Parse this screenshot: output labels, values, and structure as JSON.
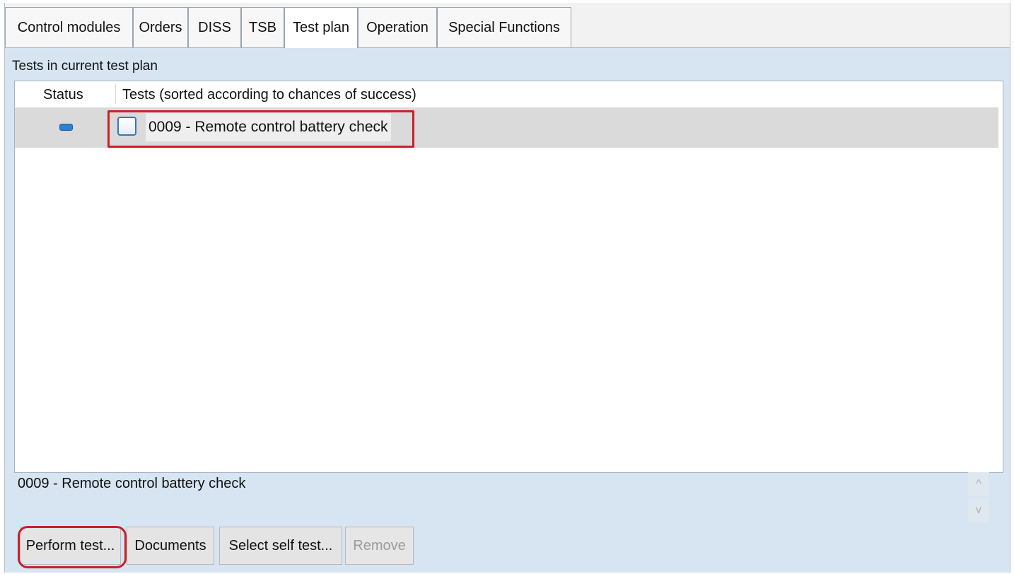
{
  "tabs": [
    {
      "label": "Control modules",
      "active": false
    },
    {
      "label": "Orders",
      "active": false
    },
    {
      "label": "DISS",
      "active": false
    },
    {
      "label": "TSB",
      "active": false
    },
    {
      "label": "Test plan",
      "active": true
    },
    {
      "label": "Operation",
      "active": false
    },
    {
      "label": "Special Functions",
      "active": false
    }
  ],
  "section_title": "Tests in current test plan",
  "table": {
    "columns": [
      "Status",
      "Tests (sorted according to chances of success)"
    ],
    "rows": [
      {
        "status_icon": "in-progress-bar-icon",
        "test_icon": "test-window-icon",
        "test": "0009  - Remote control battery check"
      }
    ]
  },
  "description": "0009  - Remote control battery check",
  "scroll": {
    "up_icon": "^",
    "down_icon": "v"
  },
  "buttons": {
    "perform": "Perform test...",
    "documents": "Documents",
    "select_self_test": "Select self test...",
    "remove": "Remove"
  },
  "colors": {
    "highlight": "#c8202a",
    "panel": "#d7e4f1",
    "status": "#2f7fd0"
  }
}
